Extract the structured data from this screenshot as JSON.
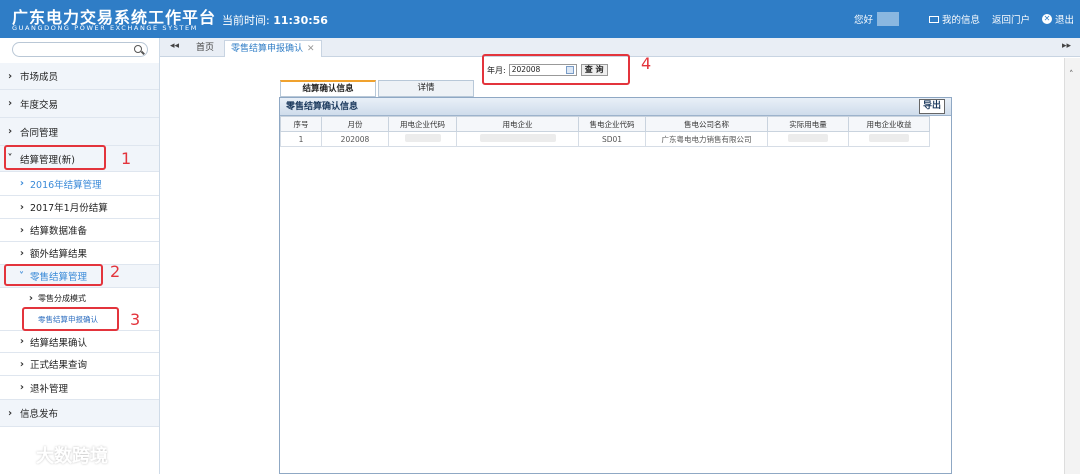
{
  "header": {
    "logo_cn": "广东电力交易系统工作平台",
    "logo_en": "GUANGDONG POWER EXCHANGE SYSTEM",
    "time_label": "当前时间:",
    "time_value": "11:30:56",
    "greeting": "您好",
    "my_info": "我的信息",
    "portal": "返回门户",
    "logout": "退出"
  },
  "sidebar": {
    "items": [
      {
        "label": "市场成员"
      },
      {
        "label": "年度交易"
      },
      {
        "label": "合同管理"
      },
      {
        "label": "结算管理(新)"
      },
      {
        "label": "2016年结算管理"
      },
      {
        "label": "2017年1月份结算"
      },
      {
        "label": "结算数据准备"
      },
      {
        "label": "额外结算结果"
      },
      {
        "label": "零售结算管理"
      },
      {
        "label": "零售分成模式"
      },
      {
        "label": "零售结算申报确认"
      },
      {
        "label": "结算结果确认"
      },
      {
        "label": "正式结果查询"
      },
      {
        "label": "退补管理"
      },
      {
        "label": "信息发布"
      }
    ]
  },
  "tabs": {
    "home": "首页",
    "current": "零售结算申报确认",
    "close": "✕"
  },
  "query": {
    "label": "年月:",
    "value": "202008",
    "button": "查 询"
  },
  "panel_tabs": [
    "结算确认信息",
    "详情"
  ],
  "panel": {
    "title": "零售结算确认信息",
    "export": "导出"
  },
  "table": {
    "headers": [
      "序号",
      "月份",
      "用电企业代码",
      "用电企业",
      "售电企业代码",
      "售电公司名称",
      "实际用电量",
      "用电企业收益"
    ],
    "rows": [
      [
        "1",
        "202008",
        "",
        "",
        "SD01",
        "广东粤电电力销售有限公司",
        "",
        ""
      ]
    ]
  },
  "annotations": [
    "1",
    "2",
    "3",
    "4"
  ],
  "watermark": "大数跨境"
}
